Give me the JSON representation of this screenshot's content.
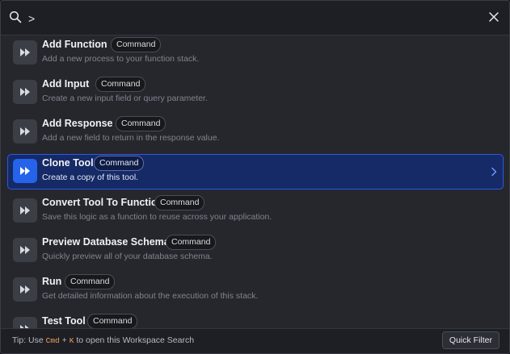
{
  "search": {
    "value": ">",
    "placeholder": ""
  },
  "items": [
    {
      "title": "Add Function",
      "badge": "Command",
      "description": "Add a new process to your function stack.",
      "icon": "fast-forward-icon"
    },
    {
      "title": "Add Input",
      "badge": "Command",
      "description": "Create a new input field or query parameter.",
      "icon": "fast-forward-icon"
    },
    {
      "title": "Add Response",
      "badge": "Command",
      "description": "Add a new field to return in the response value.",
      "icon": "fast-forward-icon"
    },
    {
      "title": "Clone Tool",
      "badge": "Command",
      "description": "Create a copy of this tool.",
      "icon": "fast-forward-icon",
      "selected": true
    },
    {
      "title": "Convert Tool To Function",
      "badge": "Command",
      "description": "Save this logic as a function to reuse across your application.",
      "icon": "fast-forward-icon"
    },
    {
      "title": "Preview Database Schemas",
      "badge": "Command",
      "description": "Quickly preview all of your database schema.",
      "icon": "fast-forward-icon"
    },
    {
      "title": "Run",
      "badge": "Command",
      "description": "Get detailed information about the execution of this stack.",
      "icon": "fast-forward-icon"
    },
    {
      "title": "Test Tool",
      "badge": "Command",
      "description": "",
      "icon": "fast-forward-icon"
    }
  ],
  "footer": {
    "tip_prefix": "Tip: Use",
    "key1": "Cmd",
    "plus": "+",
    "key2": "K",
    "tip_suffix": "to open this Workspace Search",
    "quick_filter_label": "Quick Filter"
  },
  "colors": {
    "accent": "#2563eb",
    "selected_bg": "#152a66",
    "key_highlight": "#f5a05a"
  }
}
